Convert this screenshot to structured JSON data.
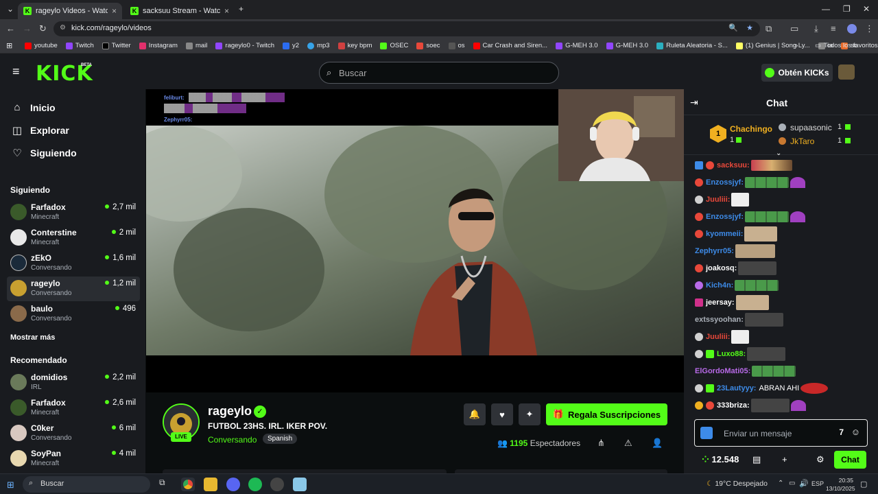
{
  "browser": {
    "tabs": [
      {
        "title": "rageylo Videos - Watch On",
        "active": true
      },
      {
        "title": "sacksuu Stream - Watch Live on",
        "active": false
      }
    ],
    "url": "kick.com/rageylo/videos",
    "bookmarks": [
      "youtube",
      "Twitch",
      "Twitter",
      "Instagram",
      "mail",
      "rageylo0 - Twitch",
      "y2",
      "mp3",
      "key bpm",
      "OSEC",
      "soec",
      "os",
      "Car Crash and Siren...",
      "G-MEH 3.0",
      "G-MEH 3.0",
      "Ruleta Aleatoria - S...",
      "(1) Genius | Song Ly...",
      "ia",
      "sc"
    ],
    "all_bookmarks": "Todos los favoritos"
  },
  "header": {
    "logo": "KICK",
    "beta": "BETA",
    "search_placeholder": "Buscar",
    "get_kicks": "Obtén KICKs"
  },
  "sidebar": {
    "nav": [
      {
        "label": "Inicio",
        "icon": "home-icon"
      },
      {
        "label": "Explorar",
        "icon": "compass-icon"
      },
      {
        "label": "Siguiendo",
        "icon": "heart-icon"
      }
    ],
    "following_title": "Siguiendo",
    "following": [
      {
        "name": "Farfadox",
        "category": "Minecraft",
        "viewers": "2,7 mil",
        "color": "#3a5a2a"
      },
      {
        "name": "Conterstine",
        "category": "Minecraft",
        "viewers": "2 mil",
        "color": "#e8e8e8"
      },
      {
        "name": "zEkO",
        "category": "Conversando",
        "viewers": "1,6 mil",
        "color": "#1a2a3a"
      },
      {
        "name": "rageylo",
        "category": "Conversando",
        "viewers": "1,2 mil",
        "color": "#c8a030"
      },
      {
        "name": "baulo",
        "category": "Conversando",
        "viewers": "496",
        "color": "#8a6a4a"
      }
    ],
    "show_more": "Mostrar más",
    "recommended_title": "Recomendado",
    "recommended": [
      {
        "name": "domidios",
        "category": "IRL",
        "viewers": "2,2 mil",
        "color": "#6a7a5a"
      },
      {
        "name": "Farfadox",
        "category": "Minecraft",
        "viewers": "2,6 mil",
        "color": "#3a5a2a"
      },
      {
        "name": "C0ker",
        "category": "Conversando",
        "viewers": "6 mil",
        "color": "#d8c8c0"
      },
      {
        "name": "SoyPan",
        "category": "Minecraft",
        "viewers": "4 mil",
        "color": "#e8d8b0"
      }
    ]
  },
  "player": {
    "overlay_names": [
      "feliburt:",
      "Zephyrr05:"
    ]
  },
  "channel": {
    "name": "rageylo",
    "live": "LIVE",
    "title": "FUTBOL 23HS. IRL. IKER POV.",
    "category": "Conversando",
    "language": "Spanish",
    "gift_label": "Regala Suscripciones",
    "viewers_count": "1195",
    "viewers_label": "Espectadores"
  },
  "chat": {
    "title": "Chat",
    "leaderboard": [
      {
        "rank": "1",
        "name": "Chachingo",
        "count": "1"
      },
      {
        "rank": "",
        "name": "supaasonic",
        "count": "1"
      },
      {
        "rank": "",
        "name": "JkTaro",
        "count": "1"
      }
    ],
    "messages": [
      {
        "user": "sacksuu:",
        "color": "#e8483a",
        "text": ""
      },
      {
        "user": "Enzossjyf:",
        "color": "#3d8be8",
        "text": ""
      },
      {
        "user": "Juuliii:",
        "color": "#e8483a",
        "text": ""
      },
      {
        "user": "Enzossjyf:",
        "color": "#3d8be8",
        "text": ""
      },
      {
        "user": "kyommeii:",
        "color": "#3d8be8",
        "text": ""
      },
      {
        "user": "Zephyrr05:",
        "color": "#3d8be8",
        "text": ""
      },
      {
        "user": "joakosq:",
        "color": "#ffffff",
        "text": ""
      },
      {
        "user": "Kich4n:",
        "color": "#3d8be8",
        "text": ""
      },
      {
        "user": "jeersay:",
        "color": "#ffffff",
        "text": ""
      },
      {
        "user": "extssyoohan:",
        "color": "#aab0b8",
        "text": ""
      },
      {
        "user": "Juuliii:",
        "color": "#e8483a",
        "text": ""
      },
      {
        "user": "Luxo88:",
        "color": "#53fc18",
        "text": ""
      },
      {
        "user": "ElGordoMati05:",
        "color": "#b86ae8",
        "text": ""
      },
      {
        "user": "23Lautyyy:",
        "color": "#3d8be8",
        "text": "ABRAN AHI"
      },
      {
        "user": "333briza:",
        "color": "#ffffff",
        "text": ""
      }
    ],
    "input_placeholder": "Enviar un mensaje",
    "points": "12.548",
    "chat_button": "Chat"
  },
  "taskbar": {
    "search": "Buscar",
    "weather": "19°C  Despejado",
    "lang": "ESP",
    "time": "20:35",
    "date": "13/10/2025"
  }
}
